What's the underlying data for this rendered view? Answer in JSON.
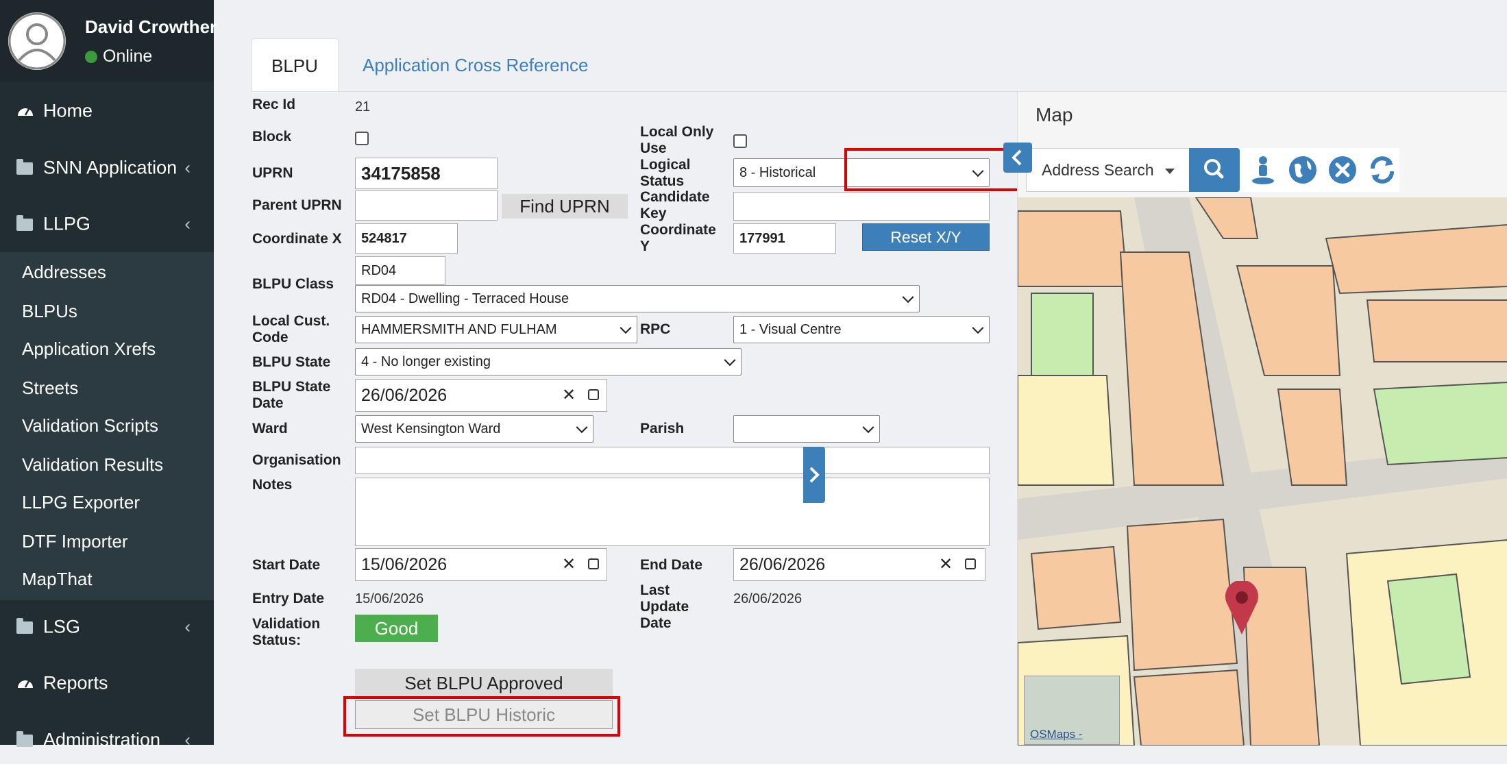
{
  "user": {
    "name": "David Crowther",
    "status": "Online"
  },
  "sidebar": {
    "items": [
      {
        "label": "Home",
        "icon": "dashboard-icon"
      },
      {
        "label": "SNN Application",
        "icon": "folder-icon",
        "chevron": "‹"
      },
      {
        "label": "LLPG",
        "icon": "folder-icon",
        "chevron": "‹"
      },
      {
        "label": "LSG",
        "icon": "folder-icon",
        "chevron": "‹"
      },
      {
        "label": "Reports",
        "icon": "dashboard-icon"
      },
      {
        "label": "Administration",
        "icon": "folder-icon",
        "chevron": "‹"
      }
    ],
    "llpg_subitems": [
      "Addresses",
      "BLPUs",
      "Application Xrefs",
      "Streets",
      "Validation Scripts",
      "Validation Results",
      "LLPG Exporter",
      "DTF Importer",
      "MapThat"
    ]
  },
  "tabs": [
    "BLPU",
    "Application Cross Reference"
  ],
  "form": {
    "rec_id": {
      "label": "Rec Id",
      "value": "21"
    },
    "block": {
      "label": "Block",
      "checked": false
    },
    "local_only_use": {
      "label": "Local Only Use",
      "checked": false
    },
    "uprn": {
      "label": "UPRN",
      "value": "34175858"
    },
    "logical_status": {
      "label": "Logical Status",
      "value": "8 - Historical"
    },
    "parent_uprn": {
      "label": "Parent UPRN",
      "value": ""
    },
    "find_uprn_button": "Find UPRN",
    "candidate_key": {
      "label": "Candidate Key",
      "value": ""
    },
    "coordinate_x": {
      "label": "Coordinate X",
      "value": "524817"
    },
    "coordinate_y": {
      "label": "Coordinate Y",
      "value": "177991"
    },
    "reset_xy_button": "Reset X/Y",
    "blpu_class": {
      "label": "BLPU Class",
      "code": "RD04",
      "value": "RD04 - Dwelling - Terraced House"
    },
    "local_cust_code": {
      "label": "Local Cust. Code",
      "value": "HAMMERSMITH AND FULHAM"
    },
    "rpc": {
      "label": "RPC",
      "value": "1 - Visual Centre"
    },
    "blpu_state": {
      "label": "BLPU State",
      "value": "4 - No longer existing"
    },
    "blpu_state_date": {
      "label": "BLPU State Date",
      "value": "26/06/2026"
    },
    "ward": {
      "label": "Ward",
      "value": "West Kensington Ward"
    },
    "parish": {
      "label": "Parish",
      "value": ""
    },
    "organisation": {
      "label": "Organisation",
      "value": ""
    },
    "notes": {
      "label": "Notes",
      "value": ""
    },
    "start_date": {
      "label": "Start Date",
      "value": "15/06/2026"
    },
    "end_date": {
      "label": "End Date",
      "value": "26/06/2026"
    },
    "entry_date": {
      "label": "Entry Date",
      "value": "15/06/2026"
    },
    "last_update_date": {
      "label": "Last Update Date",
      "value": "26/06/2026"
    },
    "validation_status": {
      "label": "Validation Status:",
      "value": "Good"
    },
    "set_approved_button": "Set BLPU Approved",
    "set_historic_button": "Set BLPU Historic",
    "clear_glyph": "✕"
  },
  "map": {
    "title": "Map",
    "address_search": "Address Search",
    "attribution": "OSMaps -",
    "icons": [
      "search-icon",
      "street-view-icon",
      "globe-icon",
      "close-circle-icon",
      "refresh-icon"
    ]
  },
  "colors": {
    "sidebar": "#222d32",
    "accent": "#3c7fb9",
    "good": "#4cae4c",
    "highlight": "#e00000"
  }
}
